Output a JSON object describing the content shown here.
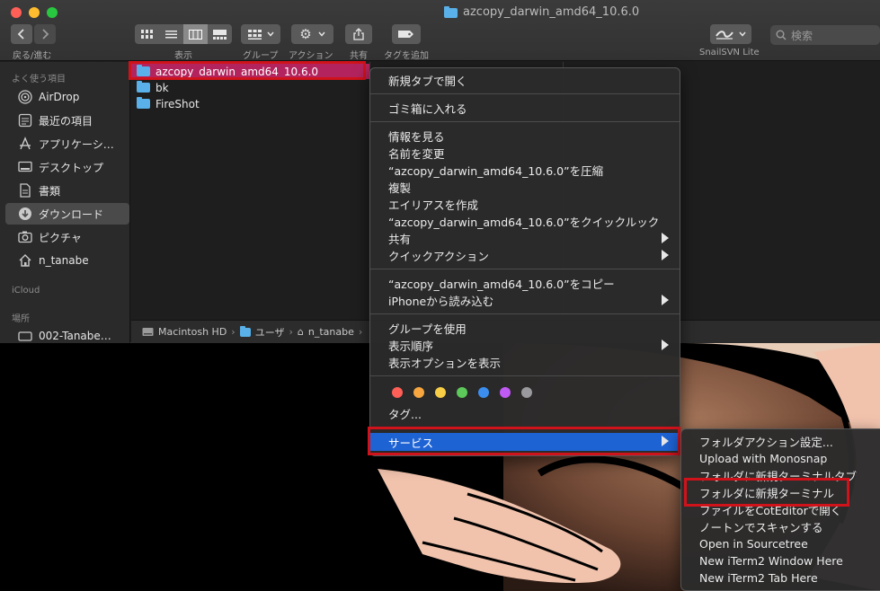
{
  "window": {
    "title": "azcopy_darwin_amd64_10.6.0"
  },
  "toolbar": {
    "back_forward_label": "戻る/進む",
    "view_label": "表示",
    "group_label": "グループ",
    "action_label": "アクション",
    "share_label": "共有",
    "tags_label": "タグを追加",
    "snailsvn_label": "SnailSVN Lite",
    "search_placeholder": "検索"
  },
  "sidebar": {
    "favorites_header": "よく使う項目",
    "items": [
      {
        "label": "AirDrop",
        "icon": "airdrop-icon"
      },
      {
        "label": "最近の項目",
        "icon": "recents-icon"
      },
      {
        "label": "アプリケーシ…",
        "icon": "applications-icon"
      },
      {
        "label": "デスクトップ",
        "icon": "desktop-icon"
      },
      {
        "label": "書類",
        "icon": "documents-icon"
      },
      {
        "label": "ダウンロード",
        "icon": "downloads-icon"
      },
      {
        "label": "ピクチャ",
        "icon": "pictures-icon"
      },
      {
        "label": "n_tanabe",
        "icon": "home-icon"
      }
    ],
    "icloud_header": "iCloud",
    "locations_header": "場所",
    "locations": [
      {
        "label": "002-Tanabe…",
        "icon": "disk-icon"
      }
    ]
  },
  "files": [
    {
      "name": "azcopy_darwin_amd64_10.6.0"
    },
    {
      "name": "bk"
    },
    {
      "name": "FireShot"
    }
  ],
  "pathbar": {
    "items": [
      "Macintosh HD",
      "ユーザ",
      "n_tanabe"
    ]
  },
  "context_menu": {
    "items": [
      "新規タブで開く",
      "ゴミ箱に入れる",
      "情報を見る",
      "名前を変更",
      "“azcopy_darwin_amd64_10.6.0”を圧縮",
      "複製",
      "エイリアスを作成",
      "“azcopy_darwin_amd64_10.6.0”をクイックルック",
      "共有",
      "クイックアクション",
      "“azcopy_darwin_amd64_10.6.0”をコピー",
      "iPhoneから読み込む",
      "グループを使用",
      "表示順序",
      "表示オプションを表示",
      "タグ...",
      "サービス"
    ],
    "tag_colors": [
      "#fe5f57",
      "#f7a640",
      "#f7ce46",
      "#5cc95a",
      "#3b8ef0",
      "#bf5af2",
      "#9a9a9e"
    ]
  },
  "services_menu": {
    "items": [
      "フォルダアクション設定...",
      "Upload with Monosnap",
      "フォルダに新規ターミナルタブ",
      "フォルダに新規ターミナル",
      "ファイルをCotEditorで開く",
      "ノートンでスキャンする",
      "Open in Sourcetree",
      "New iTerm2 Window Here",
      "New iTerm2 Tab Here"
    ]
  }
}
